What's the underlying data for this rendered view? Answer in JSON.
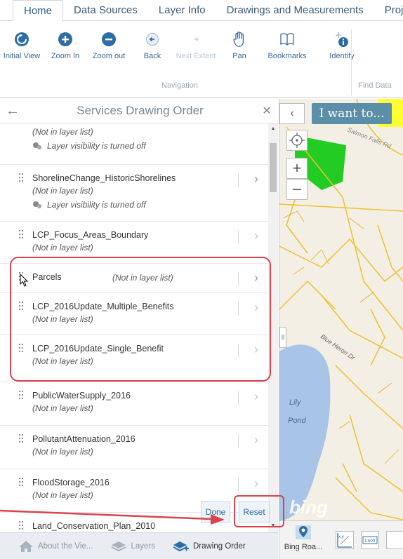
{
  "ribbon": {
    "tabs": [
      "Home",
      "Data Sources",
      "Layer Info",
      "Drawings and Measurements",
      "Proje"
    ],
    "tools": [
      {
        "label": "Initial View",
        "icon": "initial-view-icon"
      },
      {
        "label": "Zoom In",
        "icon": "zoom-in-icon"
      },
      {
        "label": "Zoom out",
        "icon": "zoom-out-icon"
      },
      {
        "label": "Back",
        "icon": "back-icon"
      },
      {
        "label": "Next Extent",
        "icon": "next-extent-icon"
      },
      {
        "label": "Pan",
        "icon": "pan-hand-icon"
      },
      {
        "label": "Bookmarks",
        "icon": "bookmarks-icon"
      },
      {
        "label": "Identify",
        "icon": "identify-icon"
      }
    ],
    "group_navigation": "Navigation",
    "group_find_data": "Find Data"
  },
  "panel": {
    "title": "Services Drawing Order",
    "items": [
      {
        "name": "",
        "sub": "(Not in layer list)",
        "vis": "Layer visibility is turned off"
      },
      {
        "name": "ShorelineChange_HistoricShorelines",
        "sub": "(Not in layer list)",
        "vis": "Layer visibility is turned off"
      },
      {
        "name": "LCP_Focus_Areas_Boundary",
        "sub": "(Not in layer list)"
      },
      {
        "name": "Parcels",
        "sub": "(Not in layer list)"
      },
      {
        "name": "LCP_2016Update_Multiple_Benefits",
        "sub": "(Not in layer list)"
      },
      {
        "name": "LCP_2016Update_Single_Benefit",
        "sub": "(Not in layer list)"
      },
      {
        "name": "PublicWaterSupply_2016",
        "sub": "(Not in layer list)"
      },
      {
        "name": "PollutantAttenuation_2016",
        "sub": "(Not in layer list)"
      },
      {
        "name": "FloodStorage_2016",
        "sub": "(Not in layer list)"
      },
      {
        "name": "Land_Conservation_Plan_2010",
        "sub": ""
      }
    ],
    "done": "Done",
    "reset": "Reset",
    "bottom_tabs": [
      "About the Vie...",
      "Layers",
      "Drawing Order"
    ]
  },
  "map": {
    "i_want_to": "I want to...",
    "bing_watermark": "bing",
    "basemap_label": "Bing Roa...",
    "labels": [
      "Lily",
      "Pond",
      "Blue Heron Dr",
      "Salmon Falls Rd"
    ],
    "colors": {
      "water": "#a8c4e6",
      "roads": "#f0c030",
      "green": "#22cc22",
      "yellow": "#ffff33"
    }
  },
  "annotation_color": "#d9434e"
}
